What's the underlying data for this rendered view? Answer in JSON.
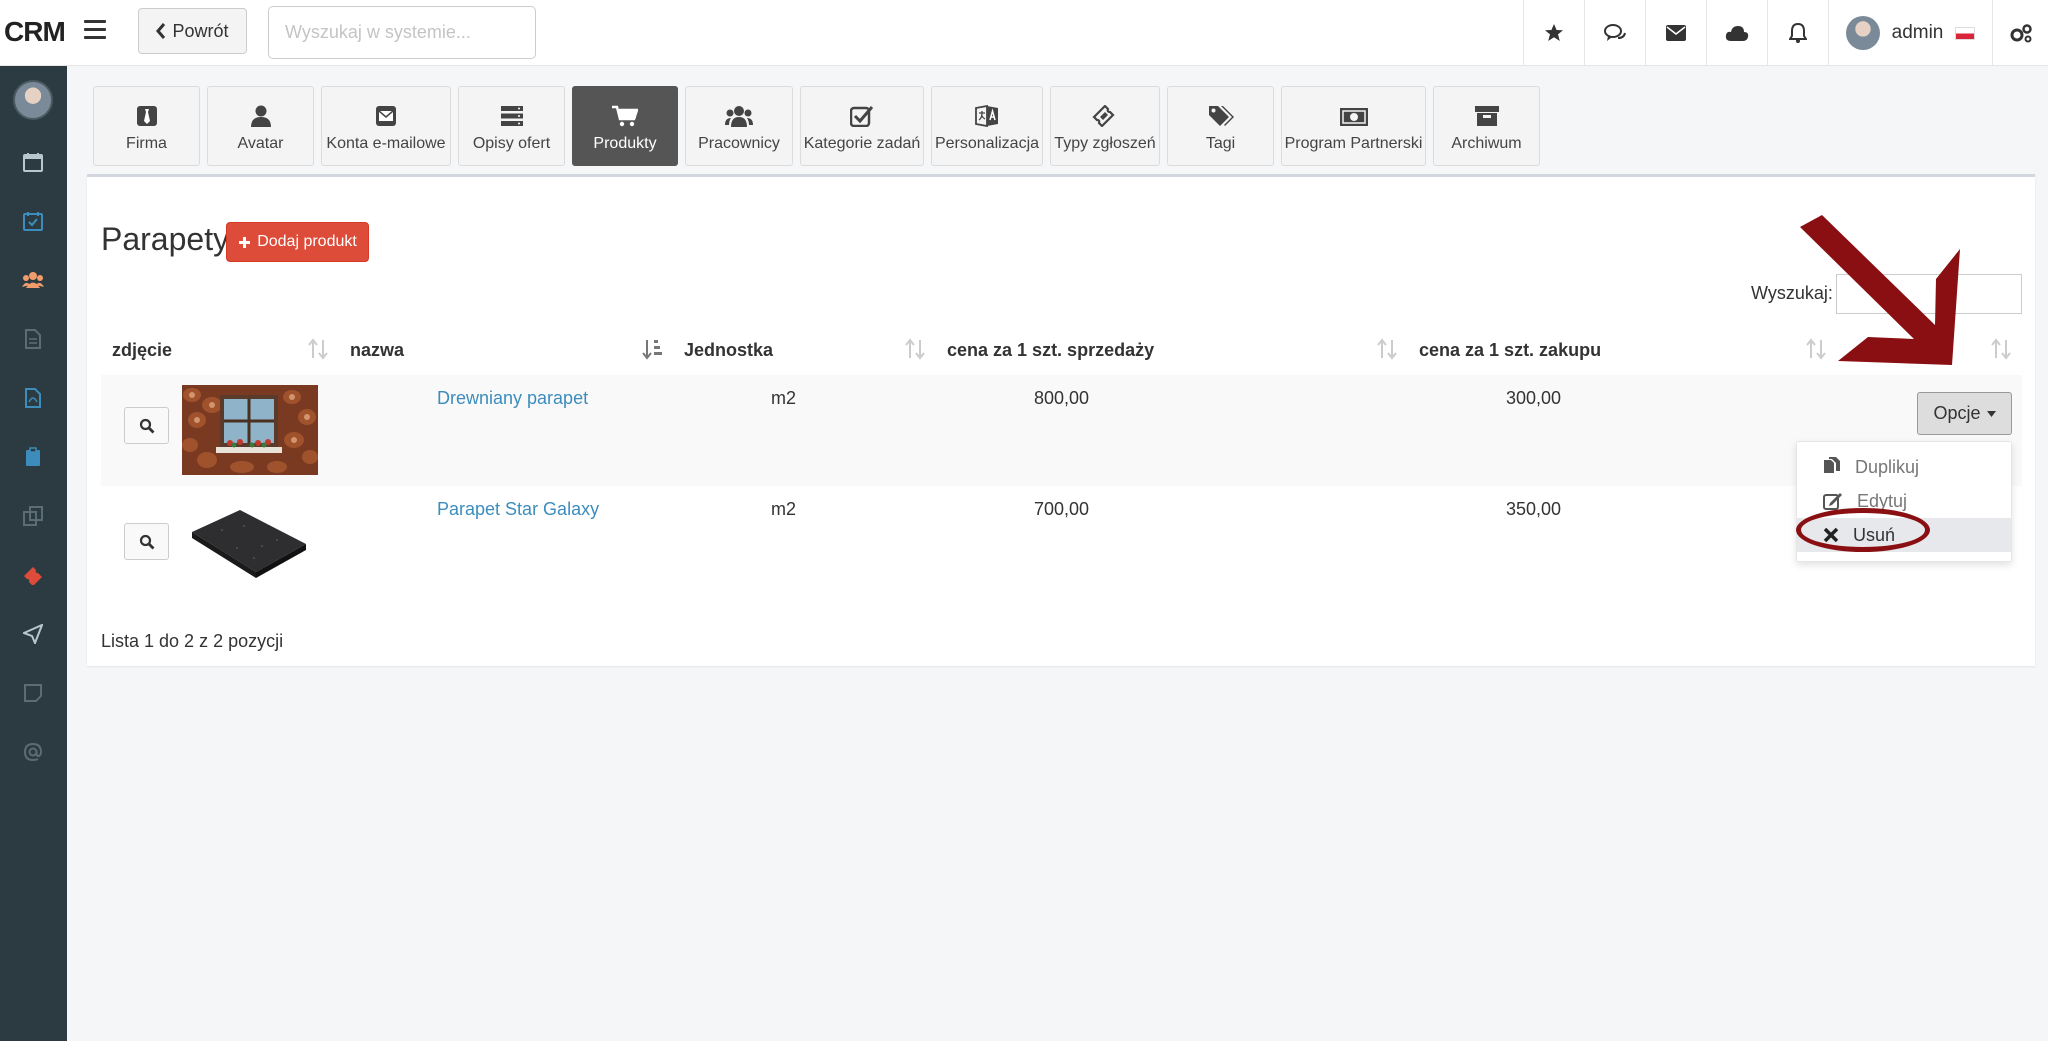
{
  "header": {
    "logo": "CRM",
    "back_label": "Powrót",
    "search_placeholder": "Wyszukaj w systemie...",
    "user_name": "admin",
    "icons": [
      "star-icon",
      "comments-icon",
      "envelope-icon",
      "cloud-icon",
      "bell-icon",
      "gears-icon"
    ]
  },
  "sidebar": {
    "icons": [
      "calendar-icon",
      "tasks-icon",
      "users-icon",
      "document-icon",
      "pdf-icon",
      "clipboard-icon",
      "copy-icon",
      "ticket-icon",
      "send-icon",
      "note-icon",
      "at-icon"
    ]
  },
  "tabs": [
    {
      "label": "Firma",
      "icon": "tie-icon"
    },
    {
      "label": "Avatar",
      "icon": "user-icon"
    },
    {
      "label": "Konta e-mailowe",
      "icon": "envelope-icon"
    },
    {
      "label": "Opisy ofert",
      "icon": "server-icon"
    },
    {
      "label": "Produkty",
      "icon": "cart-icon",
      "active": true
    },
    {
      "label": "Pracownicy",
      "icon": "users-icon"
    },
    {
      "label": "Kategorie zadań",
      "icon": "checkbox-icon"
    },
    {
      "label": "Personalizacja",
      "icon": "language-icon"
    },
    {
      "label": "Typy zgłoszeń",
      "icon": "ticket-icon"
    },
    {
      "label": "Tagi",
      "icon": "tags-icon"
    },
    {
      "label": "Program Partnerski",
      "icon": "money-icon"
    },
    {
      "label": "Archiwum",
      "icon": "archive-icon"
    }
  ],
  "main": {
    "title": "Parapety",
    "add_label": "Dodaj produkt",
    "search_label": "Wyszukaj:",
    "columns": [
      "zdjęcie",
      "nazwa",
      "Jednostka",
      "cena za 1 szt. sprzedaży",
      "cena za 1 szt. zakupu"
    ],
    "rows": [
      {
        "name": "Drewniany parapet",
        "unit": "m2",
        "sale_price": "800,00",
        "purchase_price": "300,00"
      },
      {
        "name": "Parapet Star Galaxy",
        "unit": "m2",
        "sale_price": "700,00",
        "purchase_price": "350,00"
      }
    ],
    "options_label": "Opcje",
    "dropdown": [
      {
        "label": "Duplikuj",
        "icon": "duplicate-icon"
      },
      {
        "label": "Edytuj",
        "icon": "edit-icon"
      },
      {
        "label": "Usuń",
        "icon": "times-icon",
        "highlighted": true
      }
    ],
    "footer_info": "Lista 1 do 2 z 2 pozycji"
  },
  "colors": {
    "sidebar_bg": "#2c3b41",
    "accent_red": "#dd4b39",
    "link_blue": "#3c8dbc",
    "annotation": "#8a0f12",
    "active_tab": "#555555"
  }
}
